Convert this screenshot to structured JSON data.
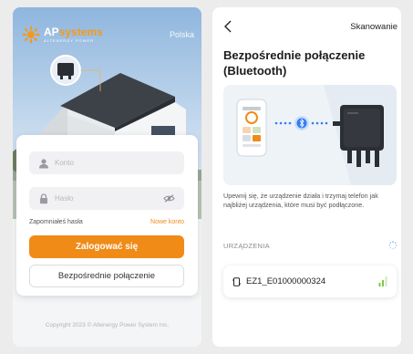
{
  "login_screen": {
    "logo_name": "APsystems",
    "logo_tagline": "ALTENERGY POWER",
    "language": "Polska",
    "username_placeholder": "Konto",
    "password_placeholder": "Hasło",
    "forgot_password": "Zapomniałeś hasła",
    "new_account": "Nowe konto",
    "login_button": "Zalogować się",
    "direct_connect_button": "Bezpośrednie połączenie",
    "copyright": "Copyright 2023 © Altenergy Power System Inc."
  },
  "bluetooth_screen": {
    "scan_action": "Skanowanie",
    "title": "Bezpośrednie połączenie (Bluetooth)",
    "description": "Upewnij się, że urządzenie działa i trzymaj telefon jak najbliżej urządzenia, które musi być podłączone.",
    "devices_section": "URZĄDZENIA",
    "devices": [
      {
        "id": "EZ1_E01000000324"
      }
    ]
  },
  "colors": {
    "accent": "#f08b18",
    "bluetooth_blue": "#2f7cf6",
    "signal_green": "#7ac943"
  },
  "icons": [
    "user-icon",
    "lock-icon",
    "eye-off-icon",
    "back-arrow-icon",
    "bluetooth-icon",
    "loading-spinner-icon",
    "device-icon",
    "signal-icon"
  ]
}
